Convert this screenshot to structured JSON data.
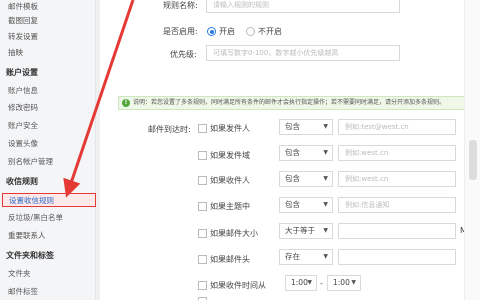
{
  "sidebar": {
    "items_top": [
      "邮件模板",
      "截图回复",
      "转发设置",
      "抽映"
    ],
    "section_account": "账户设置",
    "account_items": [
      "账户信息",
      "修改密码",
      "账户安全",
      "设置头像",
      "别名帐户管理"
    ],
    "section_rules": "收信规则",
    "rules_items": [
      "设置收信规则",
      "反垃圾/黑白名单",
      "重要联系人"
    ],
    "section_folders": "文件夹和标签",
    "folder_items": [
      "文件夹",
      "邮件标签"
    ]
  },
  "form": {
    "rule_name_label": "规则名称:",
    "rule_name_placeholder": "请输入规则的规则",
    "enable_label": "是否启用:",
    "enable_on": "开启",
    "enable_off": "不开启",
    "priority_label": "优先级:",
    "priority_placeholder": "可填写数字0-100，数字越小优先级越高",
    "notice_icon": "!",
    "notice_text": "说明：若您设置了多条规则，同时满足所有条件的邮件才会执行指定操作；若不需要同时满足，请分开添加多条规则。",
    "mail_arrive_label": "邮件到达时:",
    "conditions": [
      {
        "label": "如果发件人",
        "op": "包含",
        "placeholder": "例如:test@west.cn"
      },
      {
        "label": "如果发件域",
        "op": "包含",
        "placeholder": "例如:west.cn"
      },
      {
        "label": "如果收件人",
        "op": "包含",
        "placeholder": "例如:west.cn"
      },
      {
        "label": "如果主题中",
        "op": "包含",
        "placeholder": "例如:信息通知"
      },
      {
        "label": "如果邮件大小",
        "op": "大于等于",
        "placeholder": ""
      },
      {
        "label": "如果邮件头",
        "op": "存在",
        "placeholder": ""
      },
      {
        "label": "如果收件时间从",
        "op": "1:00",
        "op2": "1:00",
        "sep": "-"
      },
      {
        "label": "..."
      }
    ],
    "size_unit": "M",
    "select_arrow": "▼"
  },
  "colors": {
    "accent": "#2a7be4",
    "annotation_red": "#e53935",
    "notice_green": "#52a83a"
  }
}
